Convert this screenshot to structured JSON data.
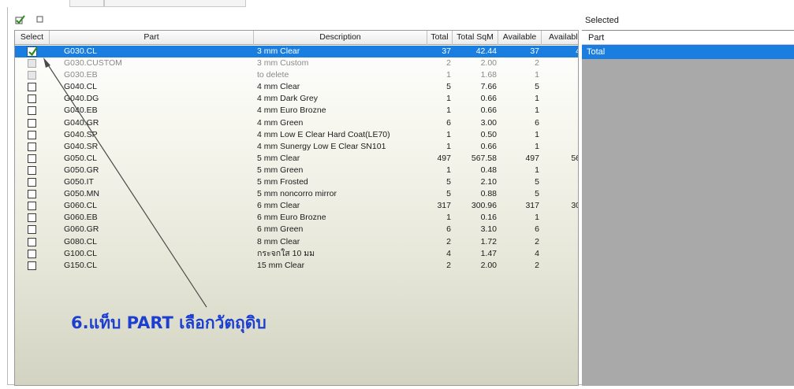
{
  "toolbar": {
    "check_all_icon": "checkmark-icon",
    "uncheck_all_icon": "empty-box-icon"
  },
  "grid": {
    "columns": [
      "Select",
      "Part",
      "Description",
      "Total",
      "Total SqM",
      "Available",
      "Availabl"
    ],
    "rows": [
      {
        "part": "G030.CL",
        "description": "3 mm Clear",
        "total": "37",
        "total_sqm": "42.44",
        "available": "37",
        "available2": "4",
        "checked": true,
        "selected": true,
        "dim": false
      },
      {
        "part": "G030.CUSTOM",
        "description": "3 mm Custom",
        "total": "2",
        "total_sqm": "2.00",
        "available": "2",
        "available2": "",
        "checked": false,
        "selected": false,
        "dim": true
      },
      {
        "part": "G030.EB",
        "description": "to delete",
        "total": "1",
        "total_sqm": "1.68",
        "available": "1",
        "available2": "",
        "checked": false,
        "selected": false,
        "dim": true
      },
      {
        "part": "G040.CL",
        "description": "4 mm Clear",
        "total": "5",
        "total_sqm": "7.66",
        "available": "5",
        "available2": "",
        "checked": false,
        "selected": false,
        "dim": false
      },
      {
        "part": "G040.DG",
        "description": "4 mm Dark Grey",
        "total": "1",
        "total_sqm": "0.66",
        "available": "1",
        "available2": "",
        "checked": false,
        "selected": false,
        "dim": false
      },
      {
        "part": "G040.EB",
        "description": "4 mm Euro Brozne",
        "total": "1",
        "total_sqm": "0.66",
        "available": "1",
        "available2": "",
        "checked": false,
        "selected": false,
        "dim": false
      },
      {
        "part": "G040.GR",
        "description": "4 mm Green",
        "total": "6",
        "total_sqm": "3.00",
        "available": "6",
        "available2": "",
        "checked": false,
        "selected": false,
        "dim": false
      },
      {
        "part": "G040.SP",
        "description": "4 mm Low E Clear Hard Coat(LE70)",
        "total": "1",
        "total_sqm": "0.50",
        "available": "1",
        "available2": "",
        "checked": false,
        "selected": false,
        "dim": false
      },
      {
        "part": "G040.SR",
        "description": "4 mm Sunergy Low E Clear SN101",
        "total": "1",
        "total_sqm": "0.66",
        "available": "1",
        "available2": "",
        "checked": false,
        "selected": false,
        "dim": false
      },
      {
        "part": "G050.CL",
        "description": "5 mm Clear",
        "total": "497",
        "total_sqm": "567.58",
        "available": "497",
        "available2": "56",
        "checked": false,
        "selected": false,
        "dim": false
      },
      {
        "part": "G050.GR",
        "description": "5 mm Green",
        "total": "1",
        "total_sqm": "0.48",
        "available": "1",
        "available2": "",
        "checked": false,
        "selected": false,
        "dim": false
      },
      {
        "part": "G050.IT",
        "description": "5 mm Frosted",
        "total": "5",
        "total_sqm": "2.10",
        "available": "5",
        "available2": "",
        "checked": false,
        "selected": false,
        "dim": false
      },
      {
        "part": "G050.MN",
        "description": "5 mm noncorro mirror",
        "total": "5",
        "total_sqm": "0.88",
        "available": "5",
        "available2": "",
        "checked": false,
        "selected": false,
        "dim": false
      },
      {
        "part": "G060.CL",
        "description": "6 mm Clear",
        "total": "317",
        "total_sqm": "300.96",
        "available": "317",
        "available2": "30",
        "checked": false,
        "selected": false,
        "dim": false
      },
      {
        "part": "G060.EB",
        "description": "6 mm Euro Brozne",
        "total": "1",
        "total_sqm": "0.16",
        "available": "1",
        "available2": "",
        "checked": false,
        "selected": false,
        "dim": false
      },
      {
        "part": "G060.GR",
        "description": "6 mm Green",
        "total": "6",
        "total_sqm": "3.10",
        "available": "6",
        "available2": "",
        "checked": false,
        "selected": false,
        "dim": false
      },
      {
        "part": "G080.CL",
        "description": "8 mm Clear",
        "total": "2",
        "total_sqm": "1.72",
        "available": "2",
        "available2": "",
        "checked": false,
        "selected": false,
        "dim": false
      },
      {
        "part": "G100.CL",
        "description": "กระจกใส 10 มม",
        "total": "4",
        "total_sqm": "1.47",
        "available": "4",
        "available2": "",
        "checked": false,
        "selected": false,
        "dim": false
      },
      {
        "part": "G150.CL",
        "description": "15 mm Clear",
        "total": "2",
        "total_sqm": "2.00",
        "available": "2",
        "available2": "",
        "checked": false,
        "selected": false,
        "dim": false
      }
    ]
  },
  "selected_panel": {
    "title": "Selected",
    "header": "Part",
    "total_label": "Total"
  },
  "annotation": {
    "text": "6.แท็บ PART เลือกวัตถุดิบ"
  },
  "colors": {
    "selection": "#1a7ee0",
    "annotation": "#1c3fd1",
    "check": "#2f8a1e"
  }
}
